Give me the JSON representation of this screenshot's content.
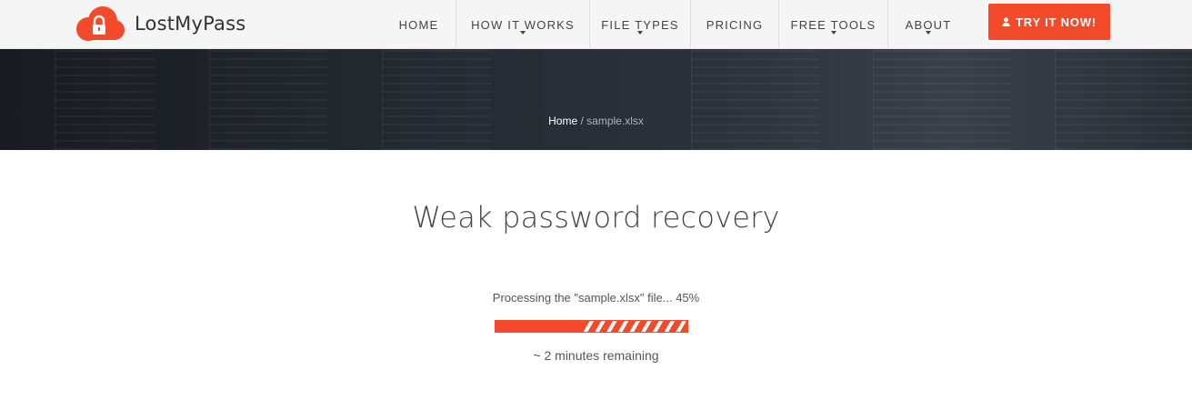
{
  "brand": {
    "name": "LostMyPass",
    "accent": "#f44a2c",
    "logo_icon": "cloud-lock-icon"
  },
  "nav": {
    "items": [
      {
        "label": "HOME",
        "dropdown": false
      },
      {
        "label": "HOW IT WORKS",
        "dropdown": true
      },
      {
        "label": "FILE TYPES",
        "dropdown": true
      },
      {
        "label": "PRICING",
        "dropdown": false
      },
      {
        "label": "FREE TOOLS",
        "dropdown": true
      },
      {
        "label": "ABOUT",
        "dropdown": true
      }
    ],
    "cta_label": "TRY IT NOW!",
    "cta_icon": "user-icon"
  },
  "breadcrumb": {
    "home": "Home",
    "separator": "/",
    "current": "sample.xlsx"
  },
  "main": {
    "title": "Weak password recovery",
    "status_text": "Processing the \"sample.xlsx\" file... 45%",
    "progress_percent": 45,
    "remaining": "~ 2 minutes remaining"
  }
}
